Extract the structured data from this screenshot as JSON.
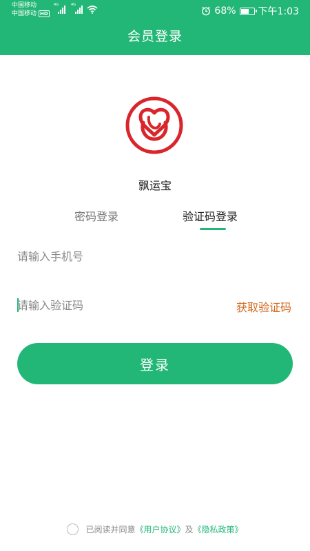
{
  "status_bar": {
    "carrier_1": "中国移动",
    "carrier_2": "中国移动",
    "hd_badge": "HD",
    "network_1": "4G",
    "network_2": "4G",
    "battery_percent": "68%",
    "battery_level": 0.68,
    "time": "下午1:03"
  },
  "header": {
    "title": "会员登录"
  },
  "app": {
    "name": "飘运宝",
    "logo_icon": "heart-knot-logo-icon",
    "logo_color": "#d9262c"
  },
  "tabs": [
    {
      "label": "密码登录",
      "active": false
    },
    {
      "label": "验证码登录",
      "active": true
    }
  ],
  "form": {
    "phone_placeholder": "请输入手机号",
    "code_placeholder": "请输入验证码",
    "get_code_label": "获取验证码",
    "login_label": "登录"
  },
  "agreement": {
    "prefix": "已阅读并同意",
    "user_agreement": "《用户协议》",
    "conjunction": "及",
    "privacy_policy": "《隐私政策》"
  },
  "colors": {
    "primary": "#23b777",
    "accent": "#d2691e"
  }
}
